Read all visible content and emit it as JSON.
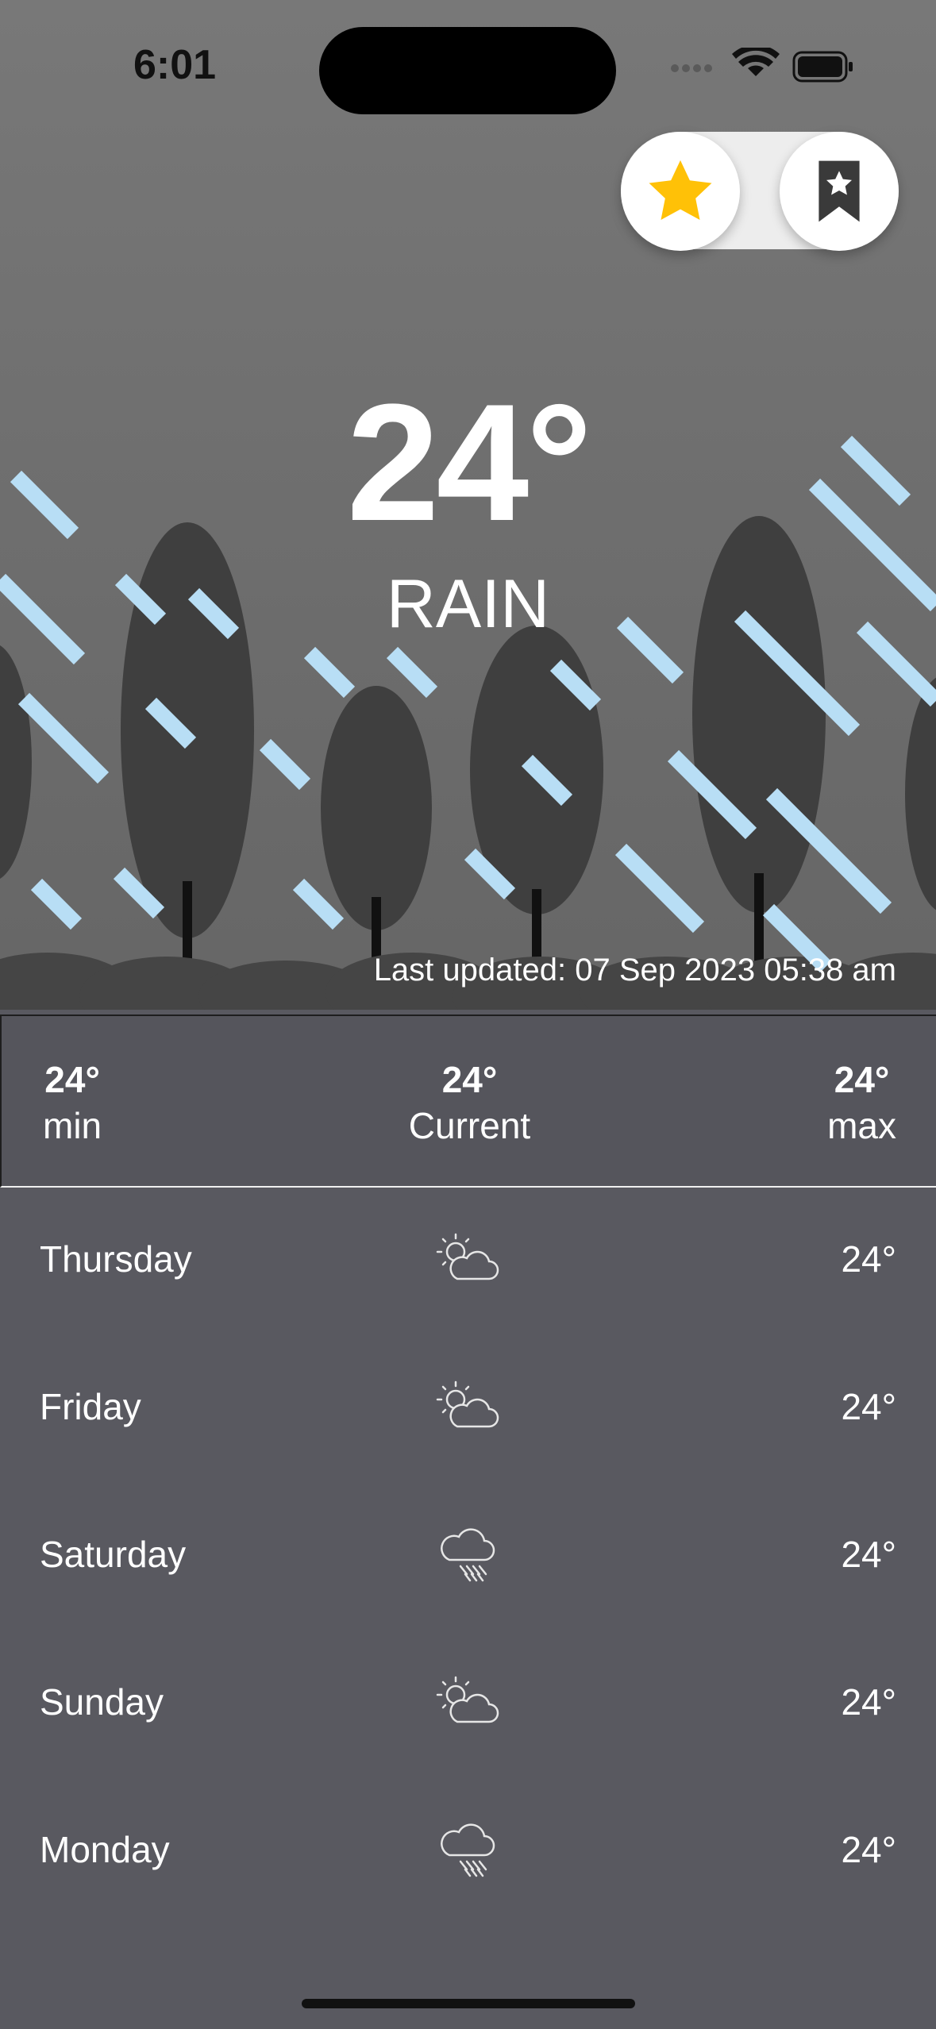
{
  "status_bar": {
    "time": "6:01"
  },
  "header": {
    "favorite_icon": "star-icon",
    "saved_icon": "bookmark-star-icon",
    "accent_color": "#FFC107"
  },
  "current": {
    "temperature": "24°",
    "condition": "RAIN",
    "last_updated": "Last updated: 07 Sep 2023 05:38 am"
  },
  "summary": {
    "min": {
      "value": "24°",
      "label": "min"
    },
    "current": {
      "value": "24°",
      "label": "Current"
    },
    "max": {
      "value": "24°",
      "label": "max"
    }
  },
  "forecast": [
    {
      "day": "Thursday",
      "icon": "partly-cloudy-icon",
      "temp": "24°"
    },
    {
      "day": "Friday",
      "icon": "partly-cloudy-icon",
      "temp": "24°"
    },
    {
      "day": "Saturday",
      "icon": "rain-cloud-icon",
      "temp": "24°"
    },
    {
      "day": "Sunday",
      "icon": "partly-cloudy-icon",
      "temp": "24°"
    },
    {
      "day": "Monday",
      "icon": "rain-cloud-icon",
      "temp": "24°"
    }
  ]
}
